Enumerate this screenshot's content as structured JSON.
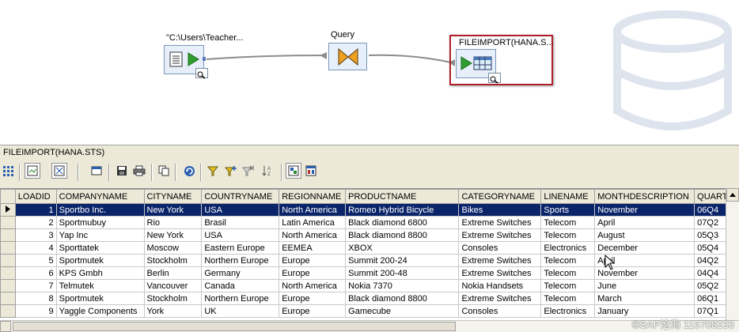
{
  "canvas": {
    "source": {
      "label": "\"C:\\Users\\Teacher..."
    },
    "query": {
      "label": "Query"
    },
    "target": {
      "label": "FILEIMPORT(HANA.S..."
    },
    "colors": {
      "connector": "#8c8c8c",
      "selection": "#b0202a",
      "node_fill": "#e6effa",
      "node_border": "#7a96b8"
    }
  },
  "panel": {
    "title": "FILEIMPORT(HANA.STS)",
    "toolbar": [
      "grid-dots-icon",
      "zoom-fit-icon",
      "zoom-area-icon",
      "window-icon",
      "save-icon",
      "print-icon",
      "copy-icon",
      "refresh-icon",
      "filter-icon",
      "add-filter-icon",
      "remove-filter-icon",
      "sort-icon",
      "view-data-icon",
      "compare-icon"
    ]
  },
  "grid": {
    "columns": [
      "LOADID",
      "COMPANYNAME",
      "CITYNAME",
      "COUNTRYNAME",
      "REGIONNAME",
      "PRODUCTNAME",
      "CATEGORYNAME",
      "LINENAME",
      "MONTHDESCRIPTION",
      "QUART"
    ],
    "rows": [
      [
        "1",
        "Sportbo Inc.",
        "New York",
        "USA",
        "North America",
        "Romeo Hybrid Bicycle",
        "Bikes",
        "Sports",
        "November",
        "06Q4"
      ],
      [
        "2",
        "Sportmubuy",
        "Rio",
        "Brasil",
        "Latin America",
        "Black diamond 6800",
        "Extreme Switches",
        "Telecom",
        "April",
        "07Q2"
      ],
      [
        "3",
        "Yap Inc",
        "New York",
        "USA",
        "North America",
        "Black diamond 8800",
        "Extreme Switches",
        "Telecom",
        "August",
        "05Q3"
      ],
      [
        "4",
        "Sporttatek",
        "Moscow",
        "Eastern Europe",
        "EEMEA",
        "XBOX",
        "Consoles",
        "Electronics",
        "December",
        "05Q4"
      ],
      [
        "5",
        "Sportmutek",
        "Stockholm",
        "Northern Europe",
        "Europe",
        "Summit 200-24",
        "Extreme Switches",
        "Telecom",
        "April",
        "04Q2"
      ],
      [
        "6",
        "KPS Gmbh",
        "Berlin",
        "Germany",
        "Europe",
        "Summit 200-48",
        "Extreme Switches",
        "Telecom",
        "November",
        "04Q4"
      ],
      [
        "7",
        "Telmutek",
        "Vancouver",
        "Canada",
        "North America",
        "Nokia 7370",
        "Nokia Handsets",
        "Telecom",
        "June",
        "05Q2"
      ],
      [
        "8",
        "Sportmutek",
        "Stockholm",
        "Northern Europe",
        "Europe",
        "Black diamond 8800",
        "Extreme Switches",
        "Telecom",
        "March",
        "06Q1"
      ],
      [
        "9",
        "Yaggle Components",
        "York",
        "UK",
        "Europe",
        "Gamecube",
        "Consoles",
        "Electronics",
        "January",
        "07Q1"
      ]
    ],
    "selected_row": 0,
    "colors": {
      "selected_bg": "#0a246a",
      "selected_fg": "#ffffff",
      "header_bg": "#ece9d8"
    }
  },
  "watermark": "©SAP沧海 115708233"
}
